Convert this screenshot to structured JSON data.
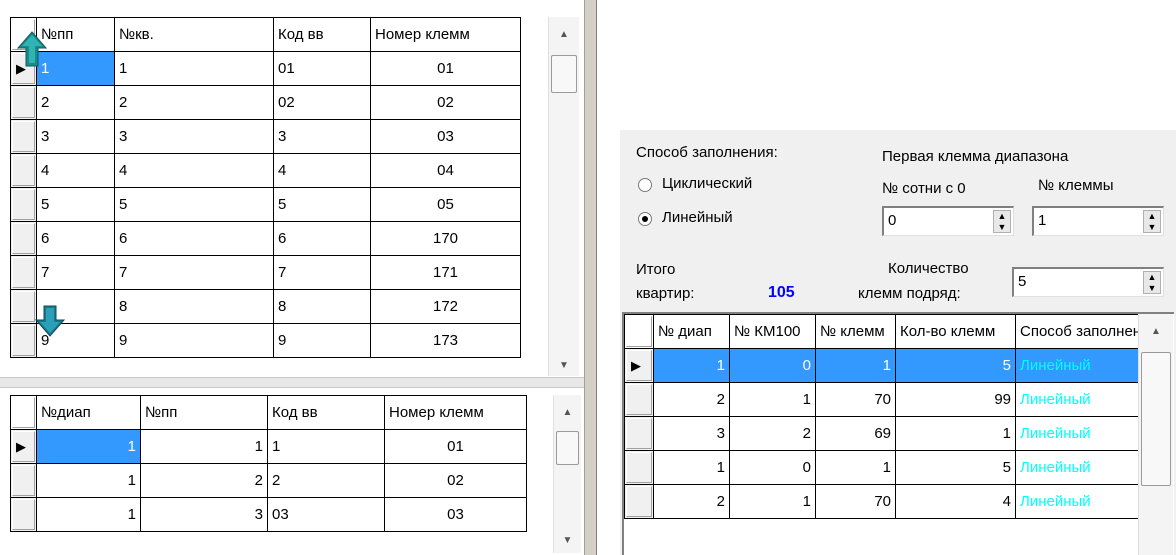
{
  "top_grid": {
    "headers": [
      "№пп",
      "№кв.",
      "Код вв",
      "Номер клемм"
    ],
    "rows": [
      [
        "1",
        "1",
        "01",
        "01"
      ],
      [
        "2",
        "2",
        "02",
        "02"
      ],
      [
        "3",
        "3",
        "3",
        "03"
      ],
      [
        "4",
        "4",
        "4",
        "04"
      ],
      [
        "5",
        "5",
        "5",
        "05"
      ],
      [
        "6",
        "6",
        "6",
        "170"
      ],
      [
        "7",
        "7",
        "7",
        "171"
      ],
      [
        "",
        "8",
        "8",
        "172"
      ],
      [
        "9",
        "9",
        "9",
        "173"
      ]
    ],
    "up_icon": "up-arrow-icon",
    "down_icon": "down-arrow-icon"
  },
  "bottom_grid": {
    "headers": [
      "№диап",
      "№пп",
      "Код вв",
      "Номер клемм"
    ],
    "rows": [
      [
        "1",
        "1",
        "1",
        "01"
      ],
      [
        "1",
        "2",
        "2",
        "02"
      ],
      [
        "1",
        "3",
        "03",
        "03"
      ]
    ]
  },
  "fill_panel": {
    "method_label": "Способ заполнения:",
    "option_cyclic": "Циклический",
    "option_linear": "Линейный",
    "selected_option": "Линейный",
    "first_terminal_label": "Первая клемма диапазона",
    "hundreds_label": "№ сотни с 0",
    "hundreds_value": "0",
    "terminal_label": "№ клеммы",
    "terminal_value": "1",
    "total_label_1": "Итого",
    "total_label_2": "квартир:",
    "total_value": "105",
    "count_label_1": "Количество",
    "count_label_2": "клемм подряд:",
    "count_value": "5"
  },
  "range_grid": {
    "headers": [
      "№ диап",
      "№ КМ100",
      "№ клемм",
      "Кол-во клемм",
      "Способ заполнения"
    ],
    "rows": [
      [
        "1",
        "0",
        "1",
        "5",
        "Линейный"
      ],
      [
        "2",
        "1",
        "70",
        "99",
        "Линейный"
      ],
      [
        "3",
        "2",
        "69",
        "1",
        "Линейный"
      ],
      [
        "1",
        "0",
        "1",
        "5",
        "Линейный"
      ],
      [
        "2",
        "1",
        "70",
        "4",
        "Линейный"
      ]
    ]
  },
  "colors": {
    "selection": "#3399ff",
    "total_value": "#0000ff",
    "method_text": "#00ffff"
  }
}
